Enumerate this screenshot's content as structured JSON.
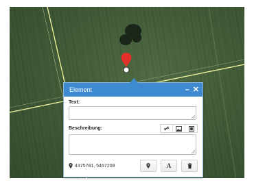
{
  "popup": {
    "title": "Element",
    "minimize_label": "–",
    "close_label": "✕",
    "text_label": "Text:",
    "text_value": "",
    "description_label": "Beschreibung:",
    "description_value": "",
    "coordinates": "4375781, 5467208",
    "text_style_button_label": "A"
  },
  "icons": {
    "pin": "map-pin-icon",
    "coords": "location-marker-icon",
    "link": "link-icon",
    "image": "image-icon",
    "film": "film-icon",
    "marker_button": "marker-icon",
    "delete": "trash-icon"
  },
  "colors": {
    "header": "#3d8ad0",
    "pin": "#e2302a"
  }
}
